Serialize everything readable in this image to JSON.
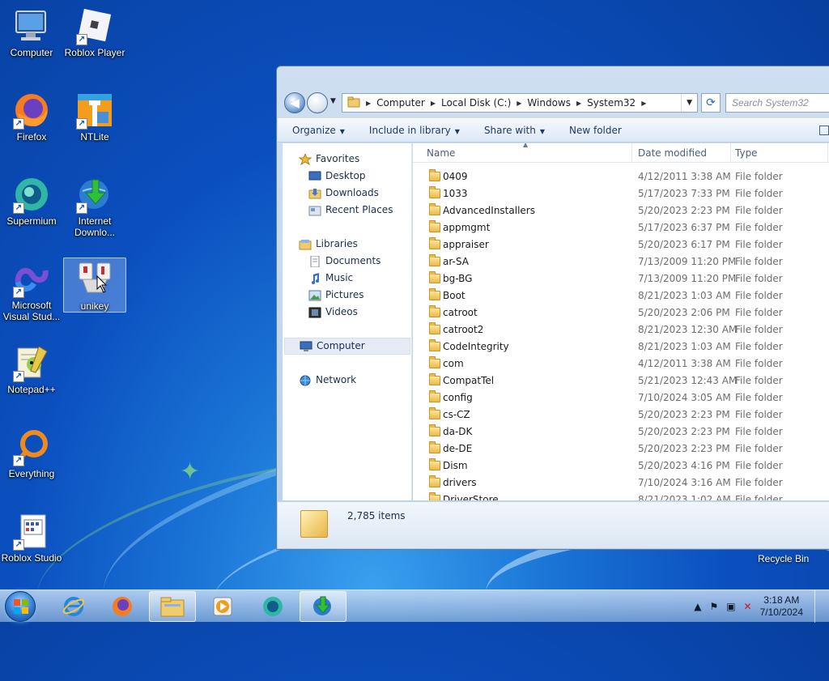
{
  "desktop": {
    "icons": [
      {
        "label": "Computer"
      },
      {
        "label": "Roblox Player"
      },
      {
        "label": "Firefox"
      },
      {
        "label": "NTLite"
      },
      {
        "label": "Supermium"
      },
      {
        "label": "Internet Downlo..."
      },
      {
        "label": "Microsoft Visual Stud..."
      },
      {
        "label": "unikey"
      },
      {
        "label": "Notepad++"
      },
      {
        "label": "Everything"
      },
      {
        "label": "Roblox Studio"
      }
    ],
    "recycle_bin": "Recycle Bin"
  },
  "explorer": {
    "breadcrumb": [
      "Computer",
      "Local Disk (C:)",
      "Windows",
      "System32"
    ],
    "search_placeholder": "Search System32",
    "toolbar": {
      "organize": "Organize",
      "include_in_library": "Include in library",
      "share_with": "Share with",
      "new_folder": "New folder"
    },
    "nav": {
      "favorites": "Favorites",
      "desktop": "Desktop",
      "downloads": "Downloads",
      "recent_places": "Recent Places",
      "libraries": "Libraries",
      "documents": "Documents",
      "music": "Music",
      "pictures": "Pictures",
      "videos": "Videos",
      "computer": "Computer",
      "network": "Network"
    },
    "columns": {
      "name": "Name",
      "date_modified": "Date modified",
      "type": "Type"
    },
    "files": [
      {
        "name": "0409",
        "date": "4/12/2011 3:38 AM",
        "type": "File folder"
      },
      {
        "name": "1033",
        "date": "5/17/2023 7:33 PM",
        "type": "File folder"
      },
      {
        "name": "AdvancedInstallers",
        "date": "5/20/2023 2:23 PM",
        "type": "File folder"
      },
      {
        "name": "appmgmt",
        "date": "5/17/2023 6:37 PM",
        "type": "File folder"
      },
      {
        "name": "appraiser",
        "date": "5/20/2023 6:17 PM",
        "type": "File folder"
      },
      {
        "name": "ar-SA",
        "date": "7/13/2009 11:20 PM",
        "type": "File folder"
      },
      {
        "name": "bg-BG",
        "date": "7/13/2009 11:20 PM",
        "type": "File folder"
      },
      {
        "name": "Boot",
        "date": "8/21/2023 1:03 AM",
        "type": "File folder"
      },
      {
        "name": "catroot",
        "date": "5/20/2023 2:06 PM",
        "type": "File folder"
      },
      {
        "name": "catroot2",
        "date": "8/21/2023 12:30 AM",
        "type": "File folder"
      },
      {
        "name": "CodeIntegrity",
        "date": "8/21/2023 1:03 AM",
        "type": "File folder"
      },
      {
        "name": "com",
        "date": "4/12/2011 3:38 AM",
        "type": "File folder"
      },
      {
        "name": "CompatTel",
        "date": "5/21/2023 12:43 AM",
        "type": "File folder"
      },
      {
        "name": "config",
        "date": "7/10/2024 3:05 AM",
        "type": "File folder"
      },
      {
        "name": "cs-CZ",
        "date": "5/20/2023 2:23 PM",
        "type": "File folder"
      },
      {
        "name": "da-DK",
        "date": "5/20/2023 2:23 PM",
        "type": "File folder"
      },
      {
        "name": "de-DE",
        "date": "5/20/2023 2:23 PM",
        "type": "File folder"
      },
      {
        "name": "Dism",
        "date": "5/20/2023 4:16 PM",
        "type": "File folder"
      },
      {
        "name": "drivers",
        "date": "7/10/2024 3:16 AM",
        "type": "File folder"
      },
      {
        "name": "DriverStore",
        "date": "8/21/2023 1:02 AM",
        "type": "File folder"
      }
    ],
    "item_count": "2,785 items"
  },
  "taskbar": {
    "time": "3:18 AM",
    "date": "7/10/2024"
  },
  "colors": {
    "accent": "#1a74d6",
    "folder": "#e9b94a"
  }
}
